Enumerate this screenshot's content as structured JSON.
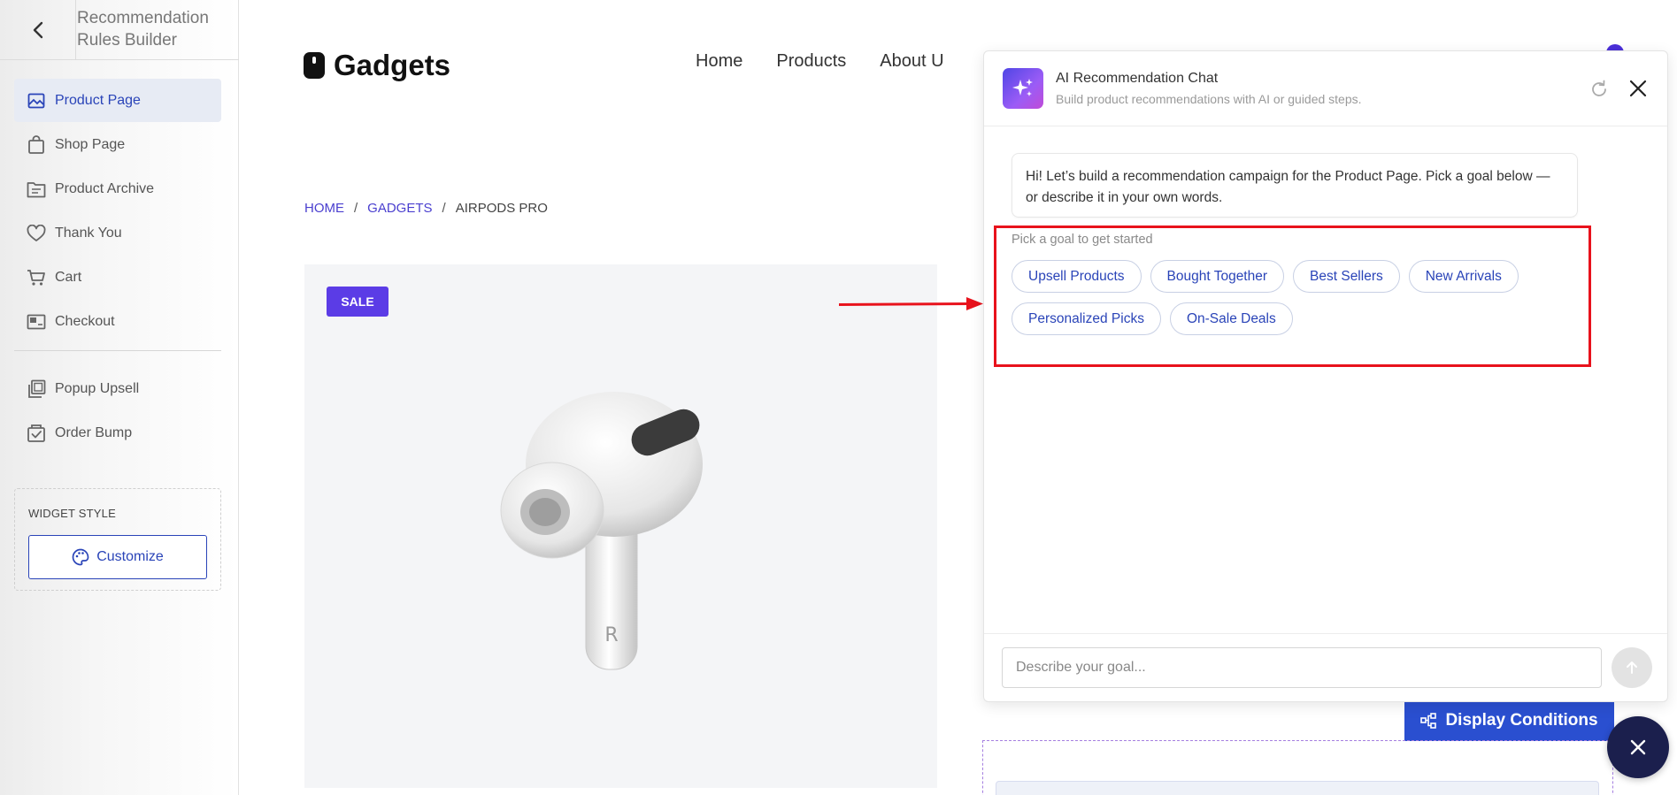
{
  "sidebar": {
    "title": "Recommendation Rules Builder",
    "items": [
      {
        "label": "Product Page",
        "icon": "image-icon",
        "active": true
      },
      {
        "label": "Shop Page",
        "icon": "shopping-bag-icon"
      },
      {
        "label": "Product Archive",
        "icon": "archive-icon"
      },
      {
        "label": "Thank You",
        "icon": "heart-icon"
      },
      {
        "label": "Cart",
        "icon": "cart-icon"
      },
      {
        "label": "Checkout",
        "icon": "checkout-icon"
      }
    ],
    "items2": [
      {
        "label": "Popup Upsell",
        "icon": "popup-icon"
      },
      {
        "label": "Order Bump",
        "icon": "order-bump-icon"
      }
    ],
    "widget_style": {
      "label": "WIDGET STYLE",
      "button": "Customize"
    }
  },
  "store": {
    "logo": "Gadgets",
    "nav": [
      "Home",
      "Products",
      "About U"
    ],
    "breadcrumb": {
      "home": "HOME",
      "category": "GADGETS",
      "current": "AIRPODS PRO"
    },
    "sale_badge": "SALE",
    "earbud_mark": "R",
    "display_conditions": "Display Conditions"
  },
  "chat": {
    "title": "AI Recommendation Chat",
    "subtitle": "Build product recommendations with AI or guided steps.",
    "greeting": "Hi! Let’s build a recommendation campaign for the Product Page. Pick a goal below — or describe it in your own words.",
    "goal_label": "Pick a goal to get started",
    "goals": [
      "Upsell Products",
      "Bought Together",
      "Best Sellers",
      "New Arrivals",
      "Personalized Picks",
      "On-Sale Deals"
    ],
    "input_placeholder": "Describe your goal..."
  },
  "colors": {
    "accent": "#2a44b8",
    "sale": "#5b3ce6",
    "highlight": "#e8121c",
    "display_conditions_bg": "#2a4fd0",
    "fab": "#1b1f4d"
  }
}
